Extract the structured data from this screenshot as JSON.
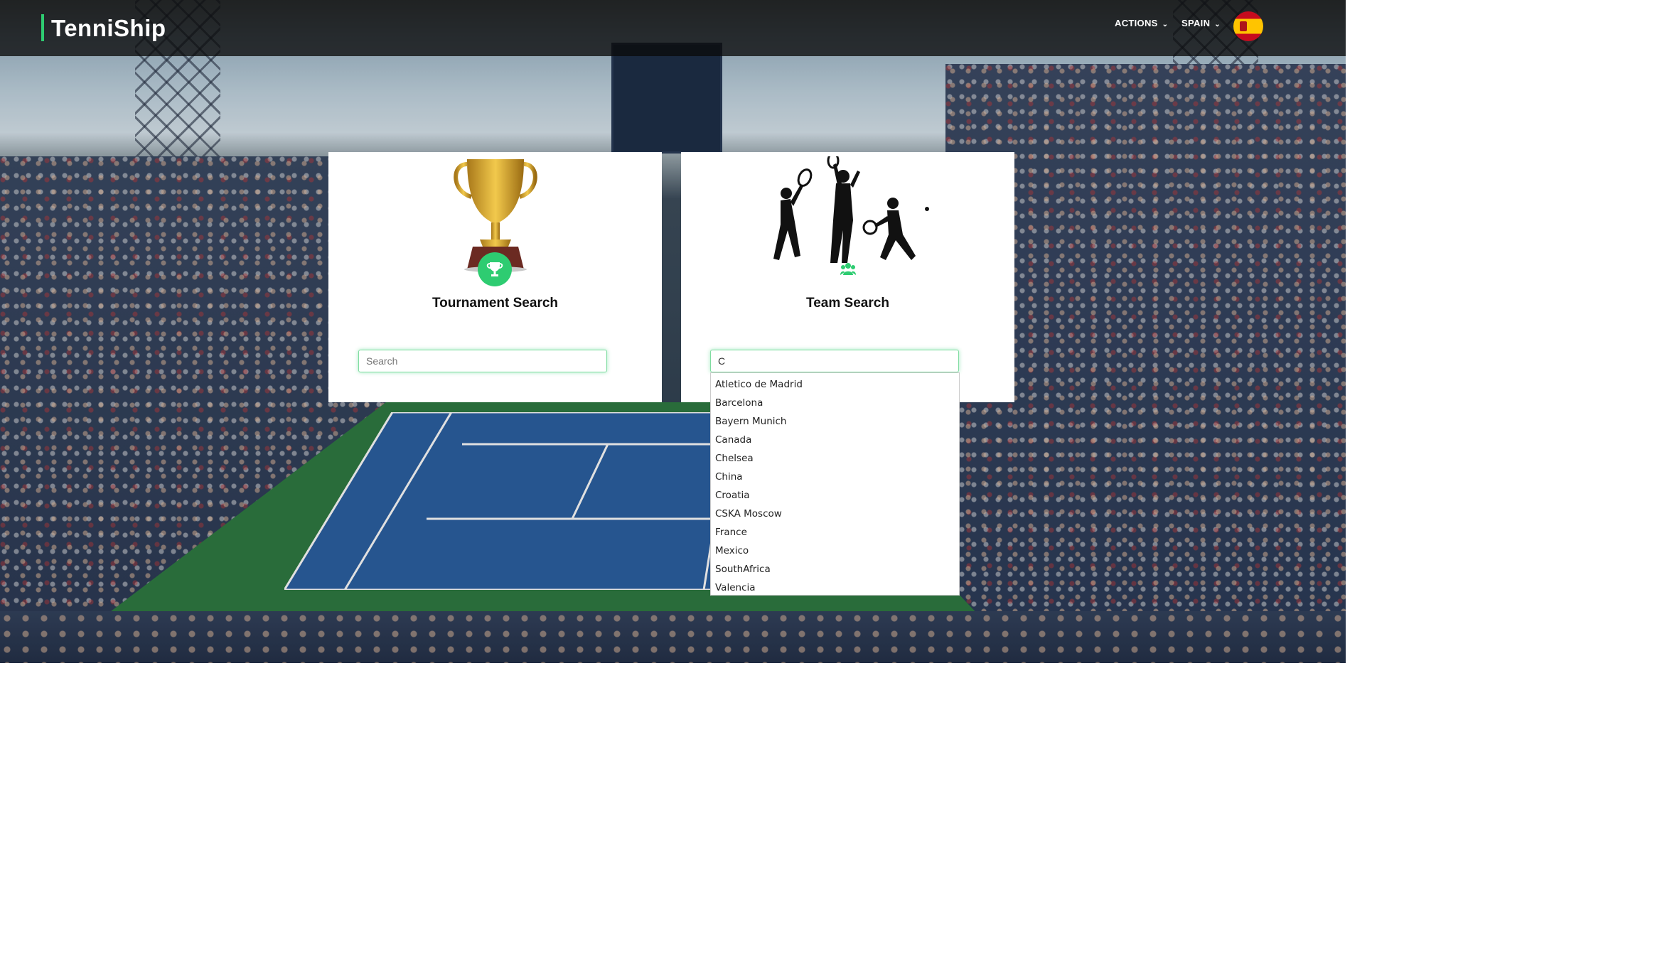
{
  "brand": {
    "name": "TenniShip",
    "accent_color": "#2ecc71"
  },
  "nav": {
    "actions_label": "ACTIONS",
    "language_label": "SPAIN",
    "flag_icon": "spain-flag-icon"
  },
  "tournament_card": {
    "title": "Tournament Search",
    "image": "trophy-image",
    "badge_icon": "trophy-icon",
    "search": {
      "placeholder": "Search",
      "value": ""
    }
  },
  "team_card": {
    "title": "Team Search",
    "image": "tennis-players-silhouette-image",
    "badge_icon": "team-icon",
    "search": {
      "placeholder": "",
      "value": "C"
    }
  },
  "autocomplete": {
    "options": [
      "Atletico de Madrid",
      "Barcelona",
      "Bayern Munich",
      "Canada",
      "Chelsea",
      "China",
      "Croatia",
      "CSKA Moscow",
      "France",
      "Mexico",
      "SouthAfrica",
      "Valencia"
    ]
  }
}
